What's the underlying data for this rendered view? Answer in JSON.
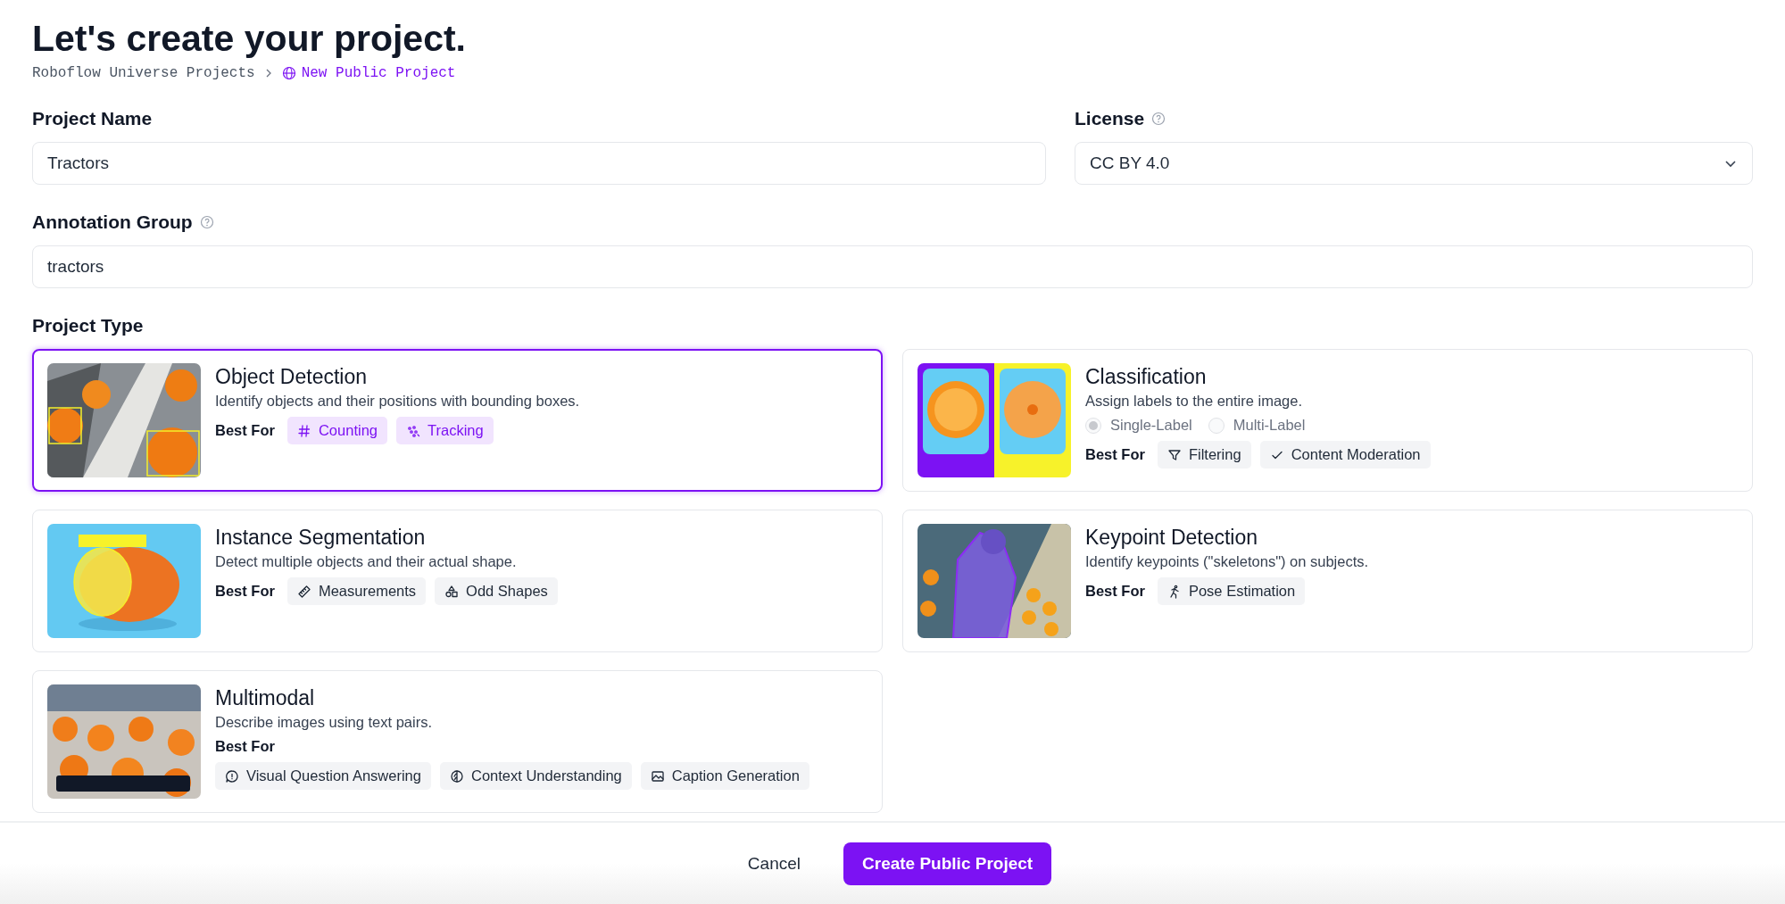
{
  "title": "Let's create your project.",
  "breadcrumb": {
    "parent": "Roboflow Universe Projects",
    "current": "New Public Project"
  },
  "fields": {
    "project_name": {
      "label": "Project Name",
      "value": "Tractors"
    },
    "license": {
      "label": "License",
      "value": "CC BY 4.0"
    },
    "annotation_group": {
      "label": "Annotation Group",
      "value": "tractors"
    }
  },
  "project_type": {
    "label": "Project Type",
    "cards": [
      {
        "title": "Object Detection",
        "description": "Identify objects and their positions with bounding boxes.",
        "selected": true,
        "best_for": "Best For",
        "tags": [
          "Counting",
          "Tracking"
        ]
      },
      {
        "title": "Classification",
        "description": "Assign labels to the entire image.",
        "selected": false,
        "options": [
          {
            "label": "Single-Label",
            "selected": true,
            "disabled": true
          },
          {
            "label": "Multi-Label",
            "selected": false,
            "disabled": true
          }
        ],
        "best_for": "Best For",
        "tags": [
          "Filtering",
          "Content Moderation"
        ]
      },
      {
        "title": "Instance Segmentation",
        "description": "Detect multiple objects and their actual shape.",
        "selected": false,
        "best_for": "Best For",
        "tags": [
          "Measurements",
          "Odd Shapes"
        ]
      },
      {
        "title": "Keypoint Detection",
        "description": "Identify keypoints (\"skeletons\") on subjects.",
        "selected": false,
        "best_for": "Best For",
        "tags": [
          "Pose Estimation"
        ]
      },
      {
        "title": "Multimodal",
        "description": "Describe images using text pairs.",
        "selected": false,
        "best_for": "Best For",
        "tags": [
          "Visual Question Answering",
          "Context Understanding",
          "Caption Generation"
        ]
      }
    ]
  },
  "buttons": {
    "cancel": "Cancel",
    "create": "Create Public Project"
  }
}
